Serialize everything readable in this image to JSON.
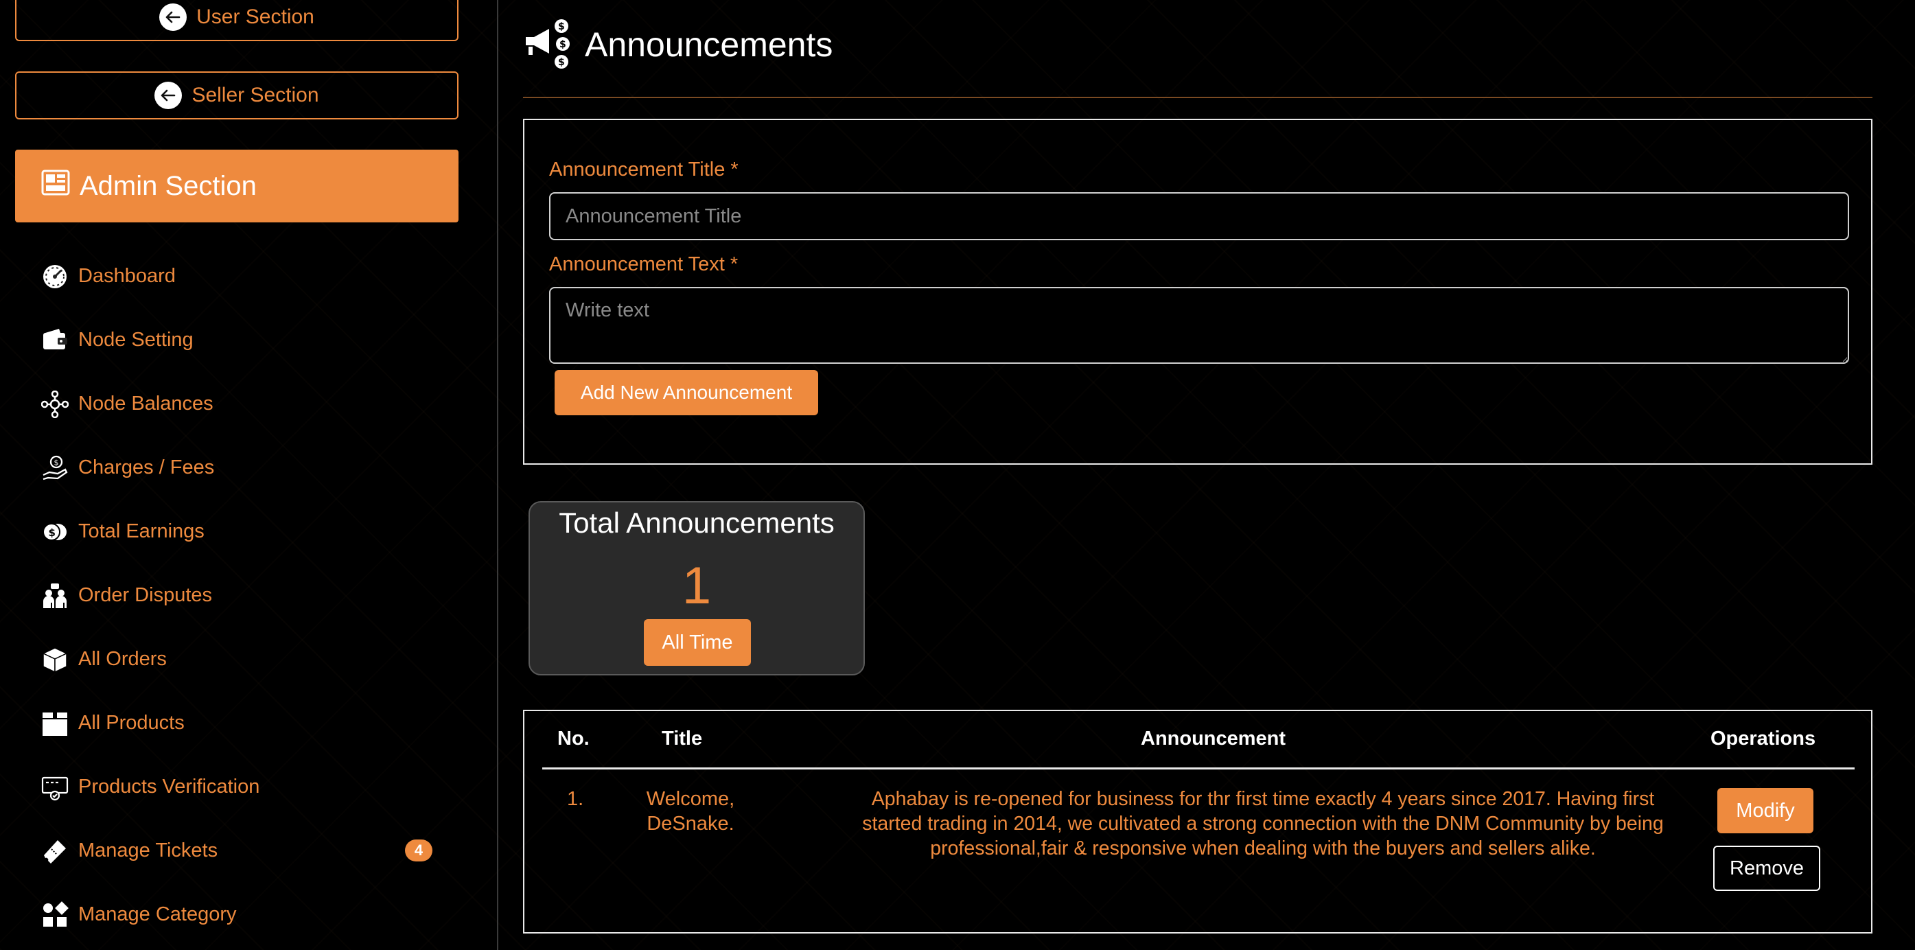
{
  "sidebar": {
    "user_section": "User Section",
    "seller_section": "Seller Section",
    "admin_section": "Admin Section",
    "items": [
      {
        "label": "Dashboard",
        "icon": "dashboard-gauge-icon"
      },
      {
        "label": "Node Setting",
        "icon": "wallet-icon"
      },
      {
        "label": "Node Balances",
        "icon": "node-network-icon"
      },
      {
        "label": "Charges / Fees",
        "icon": "hand-coin-icon"
      },
      {
        "label": "Total Earnings",
        "icon": "coins-icon"
      },
      {
        "label": "Order Disputes",
        "icon": "dispute-people-icon"
      },
      {
        "label": "All Orders",
        "icon": "package-box-icon"
      },
      {
        "label": "All Products",
        "icon": "product-box-icon"
      },
      {
        "label": "Products Verification",
        "icon": "verification-screen-icon"
      },
      {
        "label": "Manage Tickets",
        "icon": "ticket-icon",
        "badge": "4"
      },
      {
        "label": "Manage Category",
        "icon": "category-grid-icon"
      }
    ]
  },
  "page": {
    "title": "Announcements"
  },
  "form": {
    "title_label": "Announcement Title",
    "title_placeholder": "Announcement Title",
    "text_label": "Announcement Text",
    "text_placeholder": "Write text",
    "required_mark": "*",
    "submit_label": "Add New Announcement"
  },
  "stats": {
    "label": "Total Announcements",
    "value": "1",
    "period_button": "All Time"
  },
  "table": {
    "headers": [
      "No.",
      "Title",
      "Announcement",
      "Operations"
    ],
    "rows": [
      {
        "no": "1.",
        "title_line1": "Welcome,",
        "title_line2": "DeSnake.",
        "announcement_line1": "Aphabay is re-opened for business for thr first time exactly 4 years since 2017. Having first",
        "announcement_line2": "started trading in 2014, we cultivated a strong connection with the DNM Community by being",
        "announcement_line3": "professional,fair & responsive when dealing with the buyers and sellers alike.",
        "modify_label": "Modify",
        "remove_label": "Remove"
      }
    ]
  },
  "colors": {
    "accent": "#ee8a3e",
    "background": "#000000",
    "text": "#ffffff"
  }
}
